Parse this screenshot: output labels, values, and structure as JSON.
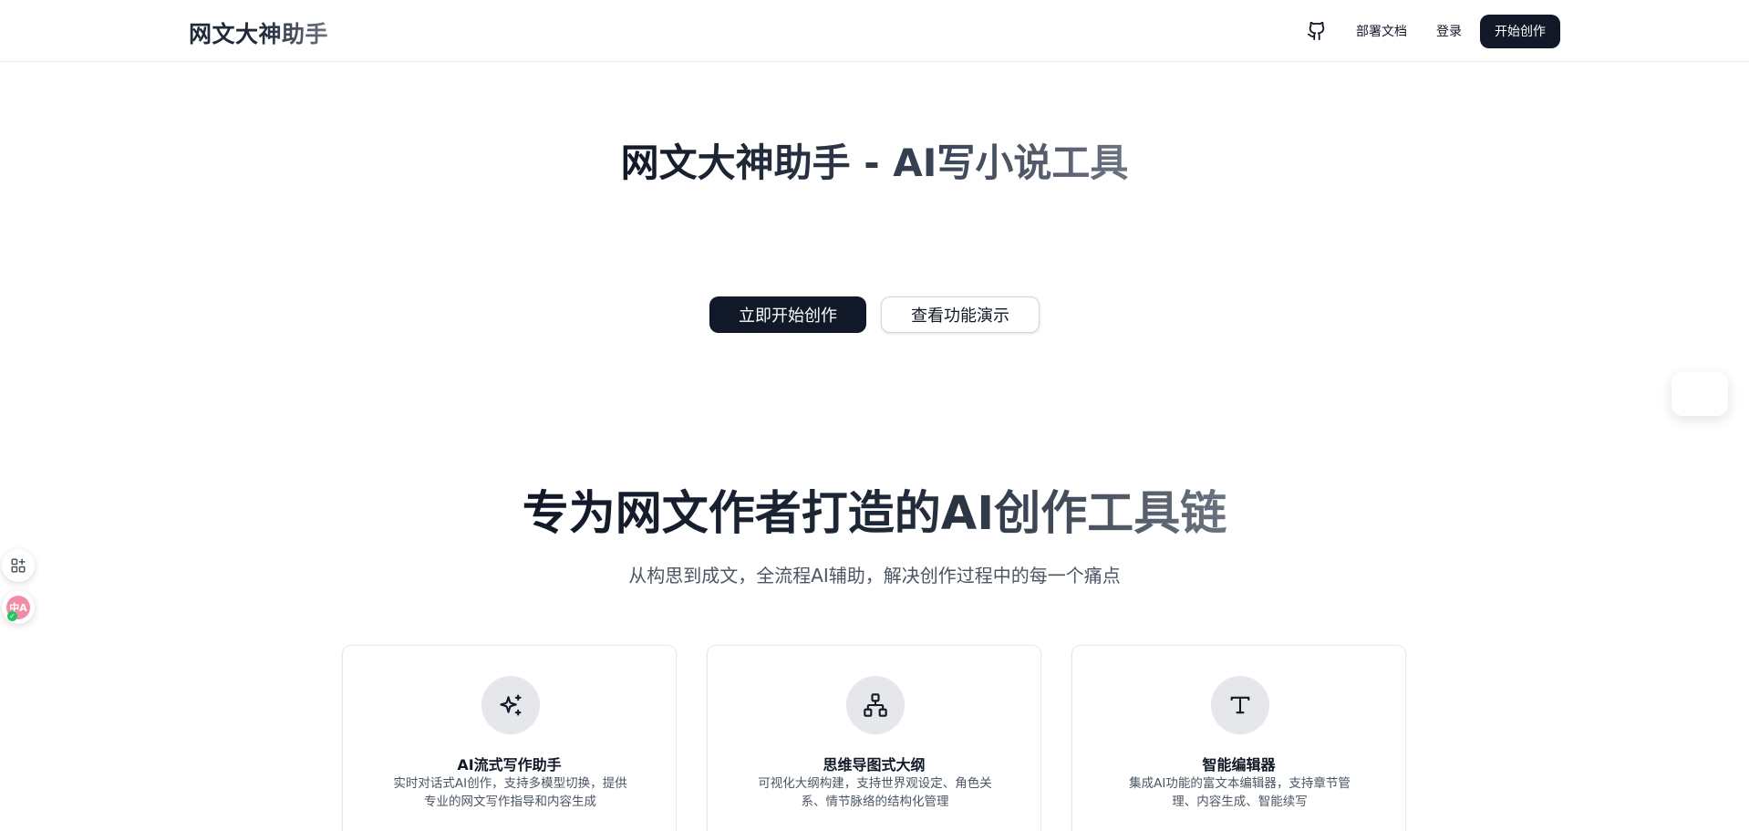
{
  "header": {
    "brand": "网文大神助手",
    "nav": {
      "docs_label": "部署文档",
      "login_label": "登录",
      "start_label": "开始创作"
    },
    "icons": {
      "github": "github-icon"
    }
  },
  "hero": {
    "title": "网文大神助手 - AI写小说工具",
    "primary_label": "立即开始创作",
    "secondary_label": "查看功能演示"
  },
  "features": {
    "title": "专为网文作者打造的AI创作工具链",
    "subtitle": "从构思到成文，全流程AI辅助，解决创作过程中的每一个痛点",
    "cards": [
      {
        "icon": "sparkles-icon",
        "title": "AI流式写作助手",
        "desc": "实时对话式AI创作，支持多模型切换，提供专业的网文写作指导和内容生成"
      },
      {
        "icon": "network-icon",
        "title": "思维导图式大纲",
        "desc": "可视化大纲构建，支持世界观设定、角色关系、情节脉络的结构化管理"
      },
      {
        "icon": "type-icon",
        "title": "智能编辑器",
        "desc": "集成AI功能的富文本编辑器，支持章节管理、内容生成、智能续写"
      }
    ]
  },
  "side_tools": {
    "apps_icon": "apps-icon",
    "translate_icon": "translate-icon",
    "translate_glyph": "中A"
  },
  "colors": {
    "primary": "#111827",
    "border": "#e5e7eb",
    "muted_text": "#4b5563",
    "icon_bg": "#e5e7eb",
    "translate_badge": "#f28ba5"
  }
}
